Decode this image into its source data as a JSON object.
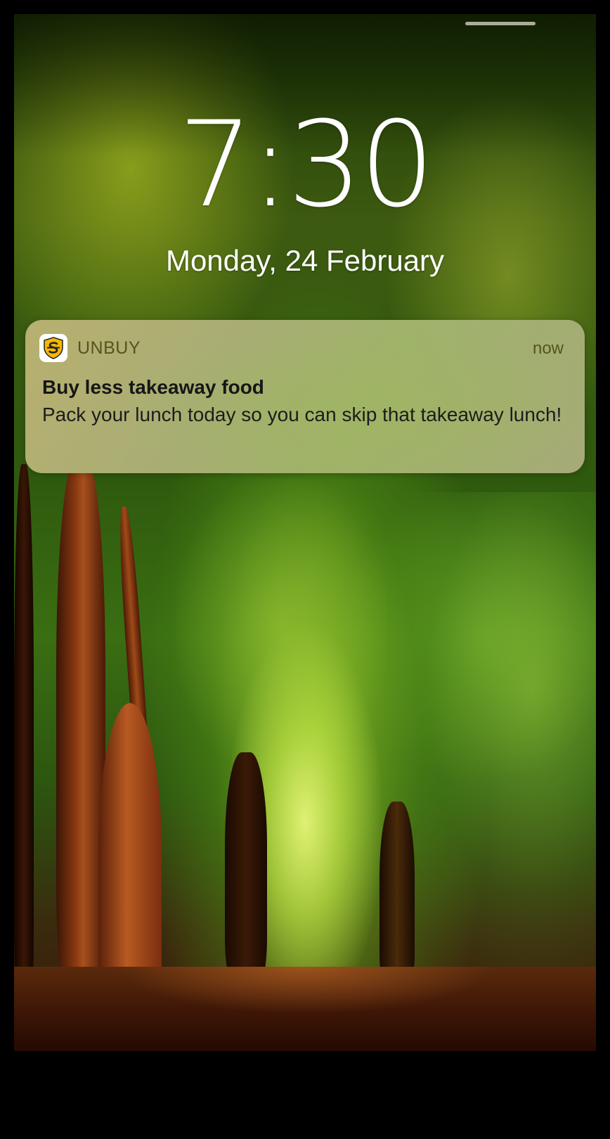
{
  "lock_screen": {
    "time": "7:30",
    "date": "Monday, 24 February"
  },
  "notification": {
    "app_name": "UNBUY",
    "app_icon": "unbuy-shield-icon",
    "time": "now",
    "title": "Buy less takeaway food",
    "body": "Pack your lunch today so you can skip that takeaway lunch!"
  },
  "colors": {
    "app_icon_accent": "#F5B800",
    "app_icon_outline": "#222222"
  }
}
